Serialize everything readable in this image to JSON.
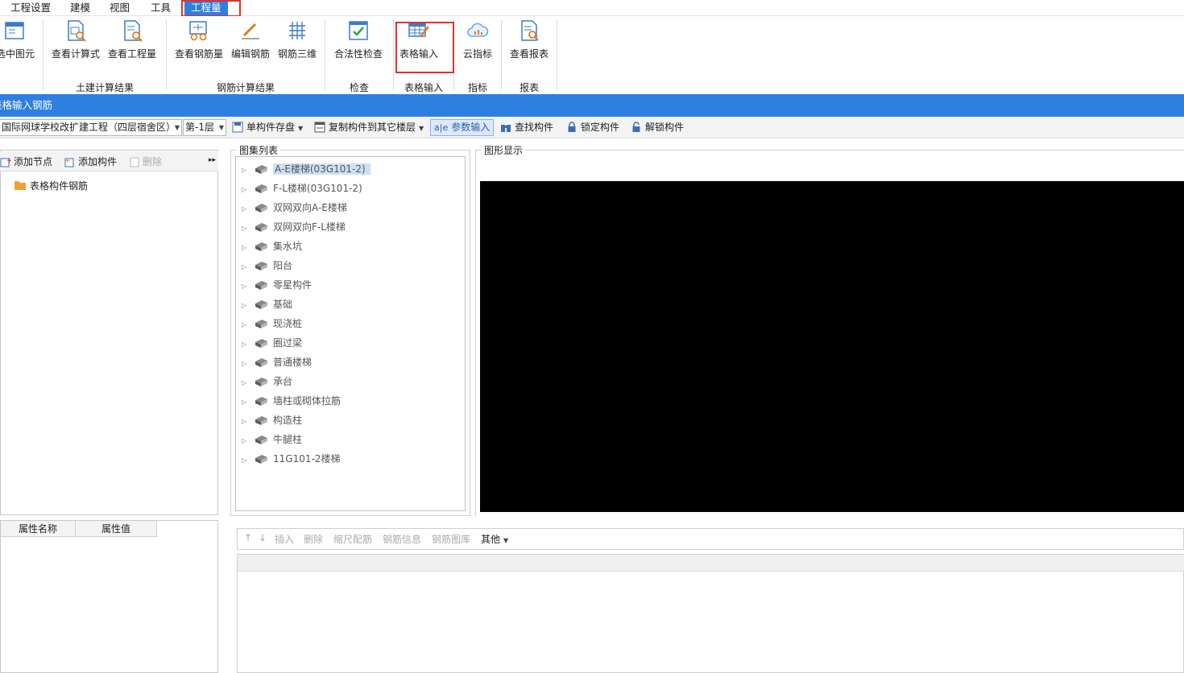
{
  "menu": {
    "items": [
      {
        "label": "工程设置"
      },
      {
        "label": "建模"
      },
      {
        "label": "视图"
      },
      {
        "label": "工具"
      },
      {
        "label": "工程量"
      }
    ]
  },
  "ribbon": {
    "buttons": {
      "select_element": "选中图元",
      "view_formula": "查看计算式",
      "view_quantity": "查看工程量",
      "view_rebar_amount": "查看钢筋量",
      "edit_rebar": "编辑钢筋",
      "rebar_3d": "钢筋三维",
      "legality_check": "合法性检查",
      "table_input": "表格输入",
      "cloud_index": "云指标",
      "view_report": "查看报表"
    },
    "groups": {
      "civil_results": "土建计算结果",
      "rebar_results": "钢筋计算结果",
      "check": "检查",
      "table_input": "表格输入",
      "index": "指标",
      "report": "报表"
    }
  },
  "window": {
    "title": "表格输入钢筋"
  },
  "toolbar": {
    "project": "国际网球学校改扩建工程（四层宿舍区）",
    "floor": "第-1层",
    "single_save": "单构件存盘",
    "copy_to_floor": "复制构件到其它楼层",
    "param_input": "参数输入",
    "find": "查找构件",
    "lock": "锁定构件",
    "unlock": "解锁构件"
  },
  "left": {
    "add_node": "添加节点",
    "add_component": "添加构件",
    "delete": "删除",
    "tree_root": "表格构件钢筋",
    "prop_name_header": "属性名称",
    "prop_value_header": "属性值"
  },
  "atlas": {
    "legend": "图集列表",
    "items": [
      "A-E楼梯(03G101-2)",
      "F-L楼梯(03G101-2)",
      "双网双向A-E楼梯",
      "双网双向F-L楼梯",
      "集水坑",
      "阳台",
      "零星构件",
      "基础",
      "现浇桩",
      "圈过梁",
      "普通楼梯",
      "承台",
      "墙柱或砌体拉筋",
      "构造柱",
      "牛腿柱",
      "11G101-2楼梯"
    ]
  },
  "graph": {
    "legend": "图形显示"
  },
  "rebar_toolbar": {
    "up": "↑",
    "down": "↓",
    "insert": "插入",
    "delete": "删除",
    "scale": "缩尺配筋",
    "info": "钢筋信息",
    "library": "钢筋图库",
    "other": "其他"
  },
  "colors": {
    "accent": "#2f7fe0",
    "highlight_box": "#e03030",
    "canvas": "#000000"
  }
}
